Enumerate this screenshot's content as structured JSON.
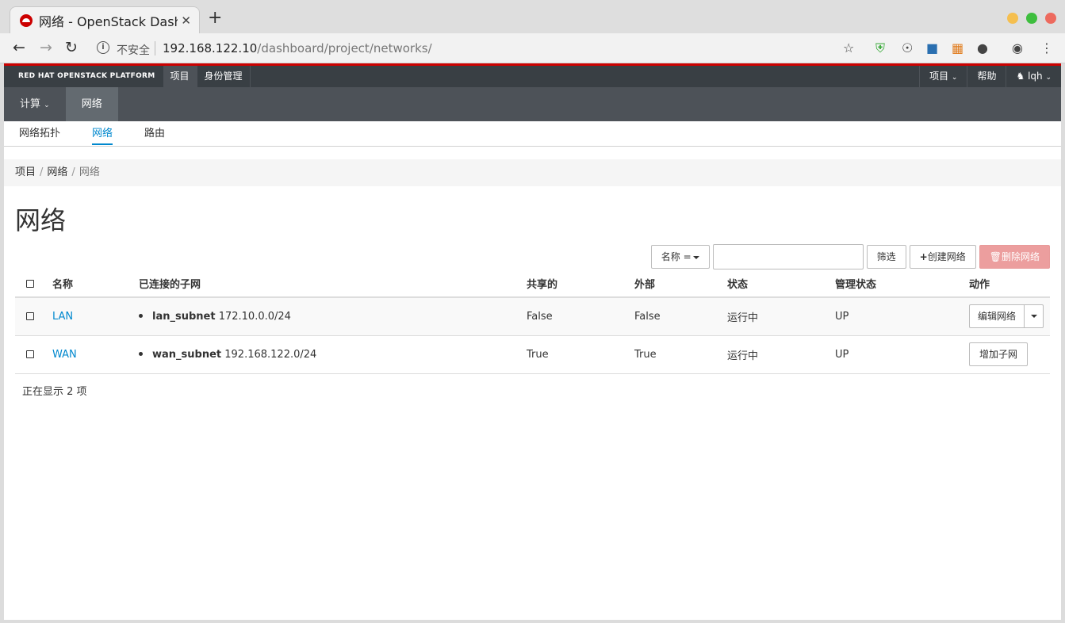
{
  "browser": {
    "tab_title": "网络 - OpenStack Dashboard",
    "tab_close": "✕",
    "newtab": "+",
    "insecure_label": "不安全",
    "url_host": "192.168.122.10",
    "url_path": "/dashboard/project/networks/",
    "star_icon": "☆"
  },
  "masthead": {
    "brand": "RED HAT OPENSTACK PLATFORM",
    "tabs": [
      "项目",
      "身份管理"
    ],
    "right": {
      "project": "项目",
      "help": "帮助",
      "user": "lqh"
    }
  },
  "nav2": {
    "items": [
      "计算",
      "网络"
    ]
  },
  "nav3": {
    "items": [
      "网络拓扑",
      "网络",
      "路由"
    ]
  },
  "breadcrumb": [
    "项目",
    "网络",
    "网络"
  ],
  "page_title": "网络",
  "filter": {
    "field_label": "名称 =",
    "input_value": "",
    "filter_button": "筛选",
    "create_button": "创建网络",
    "delete_button": "删除网络"
  },
  "table": {
    "headers": [
      "名称",
      "已连接的子网",
      "共享的",
      "外部",
      "状态",
      "管理状态",
      "动作"
    ],
    "rows": [
      {
        "name": "LAN",
        "subnet_name": "lan_subnet",
        "subnet_cidr": "172.10.0.0/24",
        "shared": "False",
        "external": "False",
        "status": "运行中",
        "admin_state": "UP",
        "action": "编辑网络"
      },
      {
        "name": "WAN",
        "subnet_name": "wan_subnet",
        "subnet_cidr": "192.168.122.0/24",
        "shared": "True",
        "external": "True",
        "status": "运行中",
        "admin_state": "UP",
        "action": "增加子网"
      }
    ]
  },
  "footer": {
    "count_text": "正在显示 2 项"
  },
  "colors": {
    "accent": "#0088ce",
    "redline": "#cc0000",
    "masthead": "#393f44",
    "nav2": "#4d5258",
    "danger": "#ec9e9e"
  }
}
